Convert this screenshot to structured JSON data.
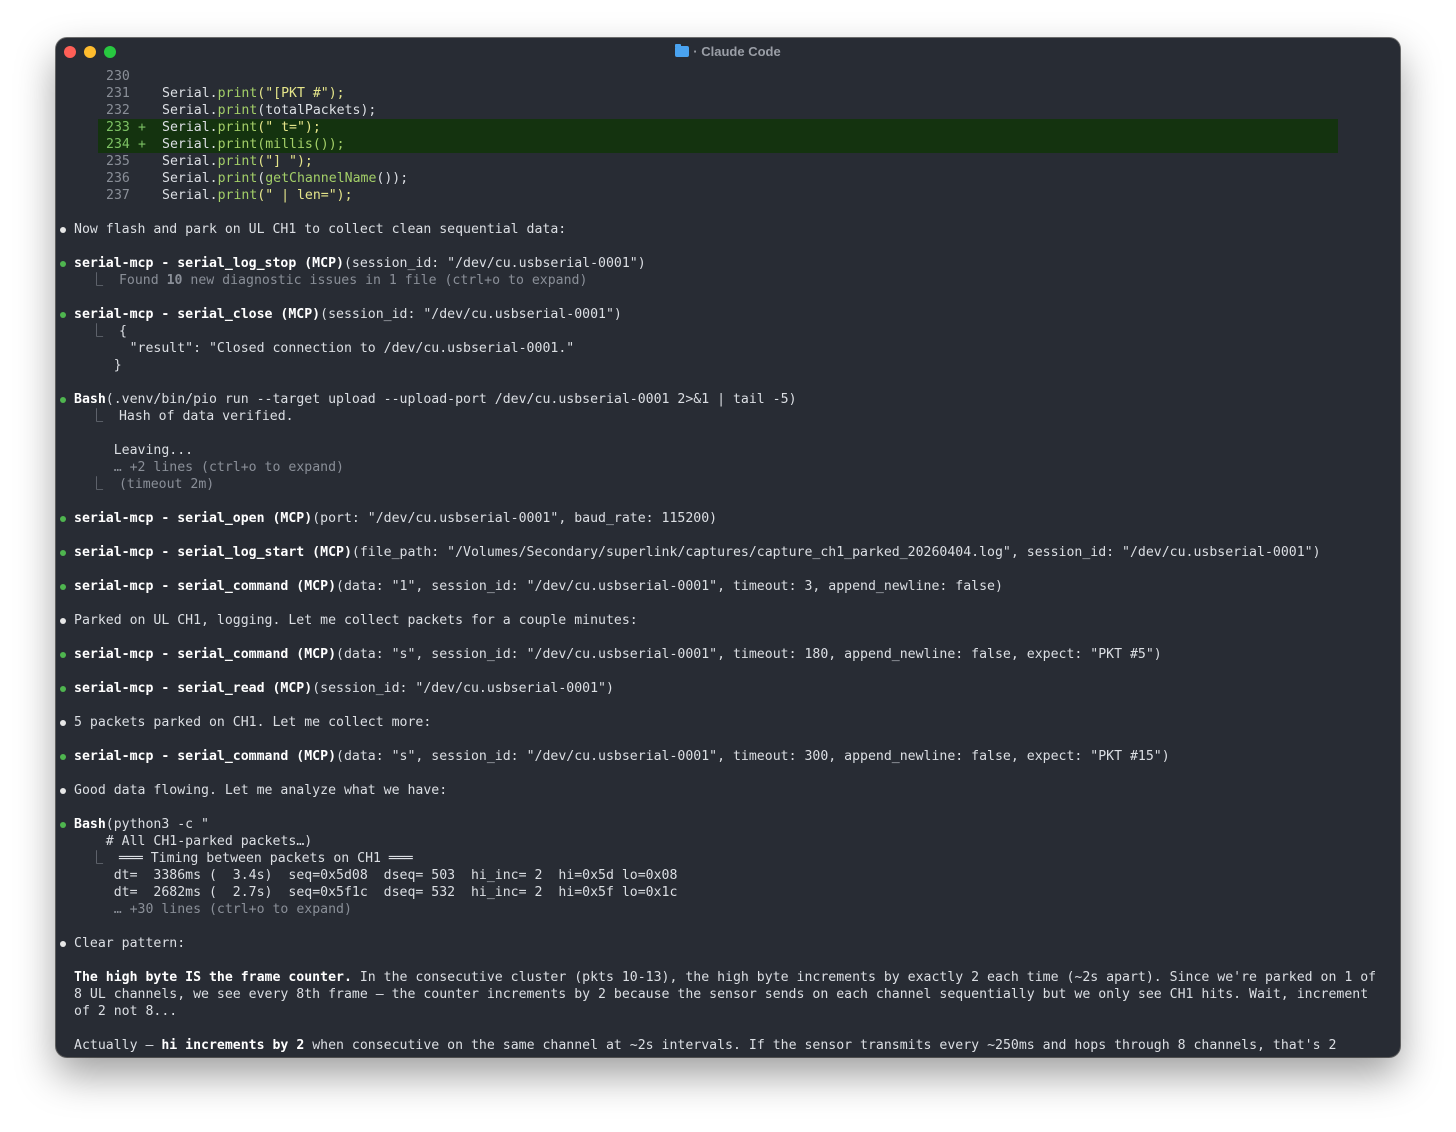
{
  "window": {
    "title": "· Claude Code",
    "folder_icon": "folder-icon"
  },
  "code_lines": [
    {
      "num": "230",
      "plus": "",
      "added": false
    },
    {
      "num": "231",
      "plus": "",
      "added": false
    },
    {
      "num": "232",
      "plus": "",
      "added": false
    },
    {
      "num": "233",
      "plus": "+",
      "added": true
    },
    {
      "num": "234",
      "plus": "+",
      "added": true
    },
    {
      "num": "235",
      "plus": "",
      "added": false
    },
    {
      "num": "236",
      "plus": "",
      "added": false
    },
    {
      "num": "237",
      "plus": "",
      "added": false
    }
  ],
  "code": {
    "l231": {
      "a": "Serial.",
      "f": "print",
      "s": "(\"[PKT #\");"
    },
    "l232": {
      "a": "Serial.",
      "f": "print",
      "s": "(totalPackets);"
    },
    "l233": {
      "a": "Serial.",
      "f": "print",
      "s": "(\" t=\");"
    },
    "l234": {
      "a": "Serial.",
      "f": "print",
      "m": "(millis());"
    },
    "l235": {
      "a": "Serial.",
      "f": "print",
      "s": "(\"] \");"
    },
    "l236": {
      "a": "Serial.",
      "f": "print",
      "p": "(",
      "g": "getChannelName",
      "e": "());"
    },
    "l237": {
      "a": "Serial.",
      "f": "print",
      "s": "(\" | len=\");"
    }
  },
  "msgs": {
    "m1": "Now flash and park on UL CH1 to collect clean sequential data:",
    "t1_name": "serial-mcp - serial_log_stop (MCP)",
    "t1_args": "(session_id: \"/dev/cu.usbserial-0001\")",
    "t1_out_a": "Found ",
    "t1_out_b": "10",
    "t1_out_c": " new diagnostic issues in 1 file (ctrl+o to expand)",
    "t2_name": "serial-mcp - serial_close (MCP)",
    "t2_args": "(session_id: \"/dev/cu.usbserial-0001\")",
    "t2_o1": "{",
    "t2_o2": "  \"result\": \"Closed connection to /dev/cu.usbserial-0001.\"",
    "t2_o3": "}",
    "t3_name": "Bash",
    "t3_args": "(.venv/bin/pio run --target upload --upload-port /dev/cu.usbserial-0001 2>&1 | tail -5)",
    "t3_o1": "Hash of data verified.",
    "t3_o2": "Leaving...",
    "t3_o3": "… +2 lines (ctrl+o to expand)",
    "t3_o4": "(timeout 2m)",
    "t4_name": "serial-mcp - serial_open (MCP)",
    "t4_args": "(port: \"/dev/cu.usbserial-0001\", baud_rate: 115200)",
    "t5_name": "serial-mcp - serial_log_start (MCP)",
    "t5_args": "(file_path: \"/Volumes/Secondary/superlink/captures/capture_ch1_parked_20260404.log\", session_id: \"/dev/cu.usbserial-0001\")",
    "t6_name": "serial-mcp - serial_command (MCP)",
    "t6_args": "(data: \"1\", session_id: \"/dev/cu.usbserial-0001\", timeout: 3, append_newline: false)",
    "m2": "Parked on UL CH1, logging. Let me collect packets for a couple minutes:",
    "t7_name": "serial-mcp - serial_command (MCP)",
    "t7_args": "(data: \"s\", session_id: \"/dev/cu.usbserial-0001\", timeout: 180, append_newline: false, expect: \"PKT #5\")",
    "t8_name": "serial-mcp - serial_read (MCP)",
    "t8_args": "(session_id: \"/dev/cu.usbserial-0001\")",
    "m3": "5 packets parked on CH1. Let me collect more:",
    "t9_name": "serial-mcp - serial_command (MCP)",
    "t9_args": "(data: \"s\", session_id: \"/dev/cu.usbserial-0001\", timeout: 300, append_newline: false, expect: \"PKT #15\")",
    "m4": "Good data flowing. Let me analyze what we have:",
    "t10_name": "Bash",
    "t10_args": "(python3 -c \"",
    "t10_cmt": "  # All CH1-parked packets…)",
    "t10_o1": "═══ Timing between packets on CH1 ═══",
    "t10_o2": "  dt=  3386ms (  3.4s)  seq=0x5d08  dseq= 503  hi_inc= 2  hi=0x5d lo=0x08",
    "t10_o3": "  dt=  2682ms (  2.7s)  seq=0x5f1c  dseq= 532  hi_inc= 2  hi=0x5f lo=0x1c",
    "t10_o4": "… +30 lines (ctrl+o to expand)",
    "m5": "Clear pattern:",
    "p1_bold": "The high byte IS the frame counter.",
    "p1_rest": " In the consecutive cluster (pkts 10-13), the high byte increments by exactly 2 each time (~2s apart). Since we're parked on 1 of 8 UL channels, we see every 8th frame — the counter increments by 2 because the sensor sends on each channel sequentially but we only see CH1 hits. Wait, increment of 2 not 8...",
    "p2_a": "Actually — ",
    "p2_bold": "hi increments by 2",
    "p2_rest": " when consecutive on the same channel at ~2s intervals. If the sensor transmits every ~250ms and hops through 8 channels, that's 2"
  },
  "colors": {
    "background": "#282c34",
    "added_line": "#14330f",
    "bullet_tool": "#4fb54f",
    "string": "#e5e58a",
    "function": "#a3cf68"
  }
}
